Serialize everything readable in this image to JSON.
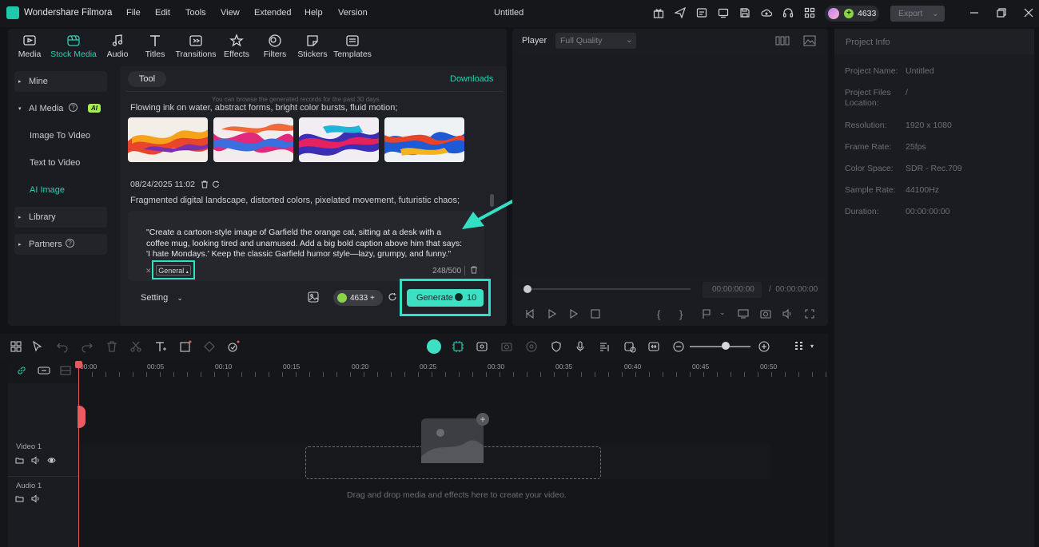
{
  "app": {
    "name": "Wondershare Filmora",
    "document_title": "Untitled",
    "menu": [
      "File",
      "Edit",
      "Tools",
      "View",
      "Extended",
      "Help",
      "Version"
    ],
    "credits": "4633",
    "export_label": "Export"
  },
  "media_tabs": [
    {
      "label": "Media",
      "icon": "media-icon"
    },
    {
      "label": "Stock Media",
      "icon": "stock-media-icon",
      "active": true
    },
    {
      "label": "Audio",
      "icon": "audio-icon"
    },
    {
      "label": "Titles",
      "icon": "titles-icon"
    },
    {
      "label": "Transitions",
      "icon": "transitions-icon"
    },
    {
      "label": "Effects",
      "icon": "effects-icon"
    },
    {
      "label": "Filters",
      "icon": "filters-icon"
    },
    {
      "label": "Stickers",
      "icon": "stickers-icon"
    },
    {
      "label": "Templates",
      "icon": "templates-icon"
    }
  ],
  "sidebar": {
    "mine": "Mine",
    "ai_media": "AI Media",
    "ai_badge": "AI",
    "image_to_video": "Image To Video",
    "text_to_video": "Text to Video",
    "ai_image": "AI Image",
    "library": "Library",
    "partners": "Partners"
  },
  "ai_image": {
    "tool_tab": "Tool",
    "downloads": "Downloads",
    "browse_note": "You can browse the generated records for the past 30 days.",
    "prev_prompt": "Flowing ink on water, abstract forms, bright color bursts, fluid motion;",
    "timestamp": "08/24/2025 11:02",
    "last_prompt": "Fragmented digital landscape, distorted colors, pixelated movement, futuristic chaos;",
    "prompt_text": "\"Create a cartoon-style image of Garfield the orange cat, sitting at a desk with a coffee mug, looking tired and unamused. Add a big bold caption above him that says: 'I hate Mondays.' Keep the classic Garfield humor style—lazy, grumpy, and funny.\"",
    "style": "General",
    "char_count": "248/500",
    "setting_label": "Setting",
    "credits": "4633",
    "generate_label": "Generate",
    "generate_cost": "10"
  },
  "player": {
    "label": "Player",
    "quality": "Full Quality",
    "current_time": "00:00:00:00",
    "total_time": "00:00:00:00"
  },
  "project_info": {
    "title": "Project Info",
    "fields": [
      {
        "key": "Project Name:",
        "value": "Untitled"
      },
      {
        "key": "Project Files Location:",
        "value": "/"
      },
      {
        "key": "Resolution:",
        "value": "1920 x 1080"
      },
      {
        "key": "Frame Rate:",
        "value": "25fps"
      },
      {
        "key": "Color Space:",
        "value": "SDR - Rec.709"
      },
      {
        "key": "Sample Rate:",
        "value": "44100Hz"
      },
      {
        "key": "Duration:",
        "value": "00:00:00:00"
      }
    ]
  },
  "timeline": {
    "ruler": [
      "00:00",
      "00:05",
      "00:10",
      "00:15",
      "00:20",
      "00:25",
      "00:30",
      "00:35",
      "00:40",
      "00:45",
      "00:50"
    ],
    "video_track": "Video 1",
    "audio_track": "Audio 1",
    "drop_hint": "Drag and drop media and effects here to create your video."
  }
}
